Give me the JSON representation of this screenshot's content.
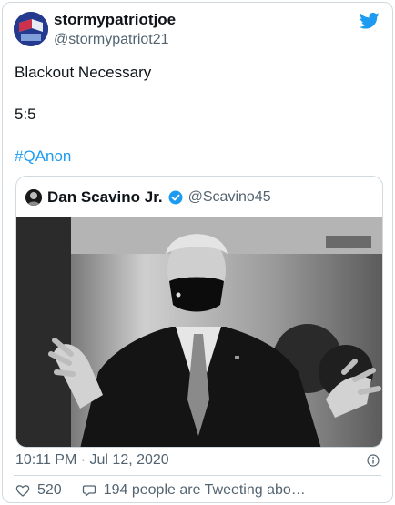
{
  "author": {
    "display_name": "stormypatriotjoe",
    "handle": "@stormypatriot21"
  },
  "tweet": {
    "line1": "Blackout Necessary",
    "line2": "5:5",
    "hashtag": "#QAnon"
  },
  "quoted": {
    "display_name": "Dan Scavino Jr.",
    "handle": "@Scavino45",
    "verified": true
  },
  "footer": {
    "timestamp": "10:11 PM · Jul 12, 2020",
    "like_count": "520",
    "tweeting_text": "194 people are Tweeting abo…"
  },
  "colors": {
    "accent": "#1d9bf0",
    "secondary_text": "#536471",
    "border": "#cfd9de"
  },
  "icons": [
    "twitter-bird-icon",
    "verified-badge-icon",
    "info-icon",
    "heart-icon",
    "reply-bubble-icon"
  ]
}
